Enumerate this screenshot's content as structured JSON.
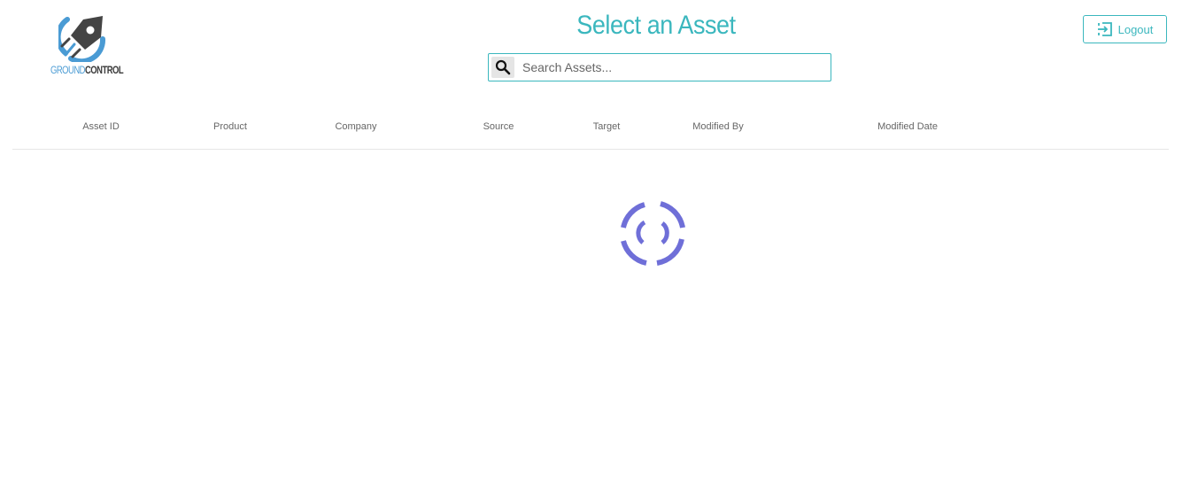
{
  "app": {
    "logo_text_1": "GROUND",
    "logo_text_2": "CONTROL",
    "brand_color": "#3bb7be",
    "logo_blue": "#4a9bd4",
    "logo_dark": "#3a3a3a"
  },
  "header": {
    "title": "Select an Asset",
    "logout_label": "Logout",
    "logout_icon": "logout-icon"
  },
  "search": {
    "placeholder": "Search Assets...",
    "value": "",
    "icon": "search-icon"
  },
  "table": {
    "columns": [
      "Asset ID",
      "Product",
      "Company",
      "Source",
      "Target",
      "Modified By",
      "Modified Date"
    ],
    "rows": []
  },
  "loading": {
    "spinner_color": "#6f6fd8",
    "icon": "loading-spinner-icon"
  }
}
